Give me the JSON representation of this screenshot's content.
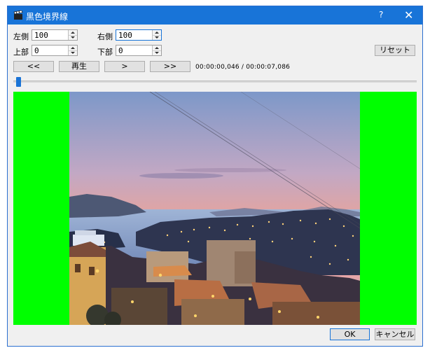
{
  "window": {
    "title": "黒色境界線",
    "help_label": "?",
    "close_label": "✕",
    "icon": "clapperboard-icon"
  },
  "margins": {
    "left": {
      "label": "左側",
      "value": "100"
    },
    "right": {
      "label": "右側",
      "value": "100"
    },
    "top": {
      "label": "上部",
      "value": "0"
    },
    "bottom": {
      "label": "下部",
      "value": "0"
    }
  },
  "buttons": {
    "reset": "リセット",
    "prev": "<<",
    "play": "再生",
    "step": ">",
    "next": ">>",
    "ok": "OK",
    "cancel": "キャンセル"
  },
  "playback": {
    "timecode": "00:00:00,046 / 00:00:07,086",
    "position_fraction": 0.0065
  },
  "colors": {
    "border_fill": "#00ff00",
    "accent": "#1874d8"
  }
}
